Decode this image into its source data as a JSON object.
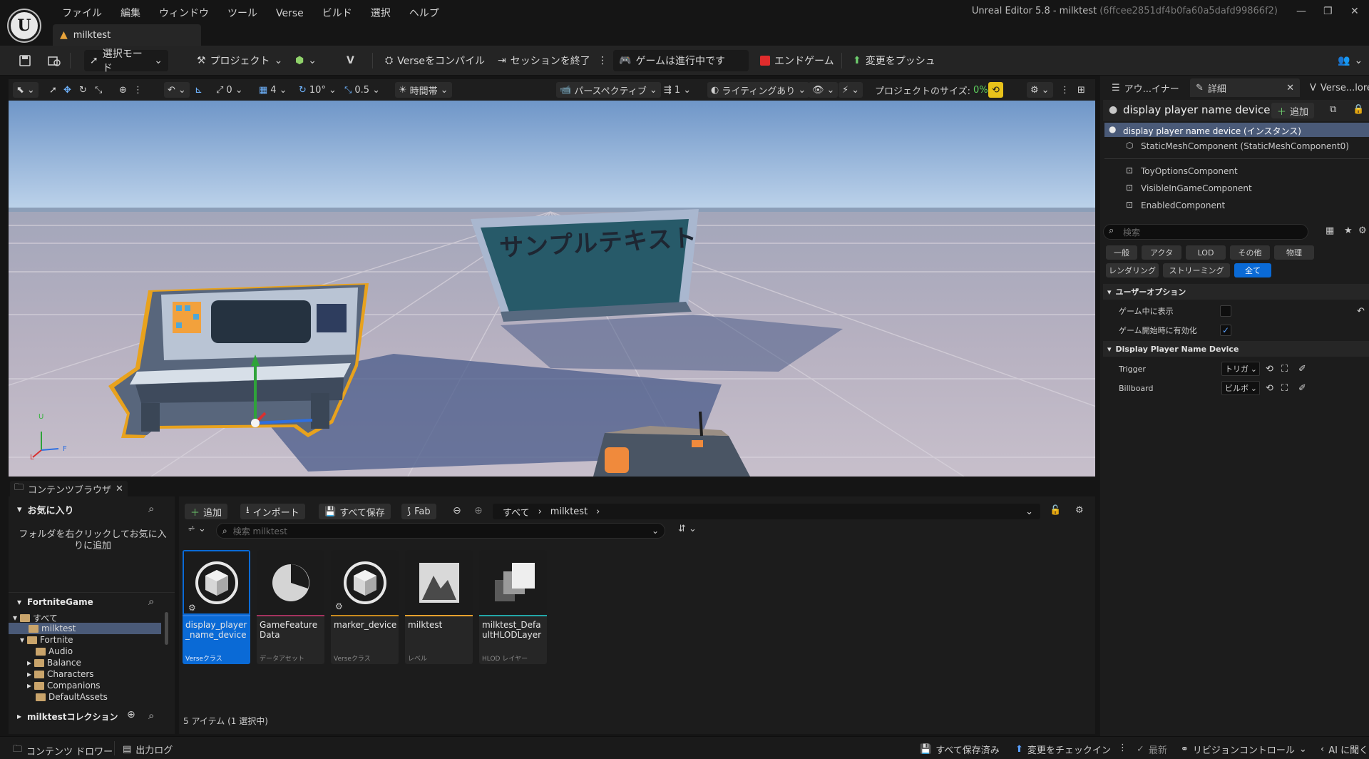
{
  "menubar": {
    "logo": "U",
    "items": [
      "ファイル",
      "編集",
      "ウィンドウ",
      "ツール",
      "Verse",
      "ビルド",
      "選択",
      "ヘルプ"
    ],
    "window_title": "Unreal Editor 5.8 - milktest",
    "window_hash": "(6ffcee2851df4b0fa60a5dafd99866f2)",
    "level_tab": "milktest"
  },
  "toolbar": {
    "select_mode": "選択モード",
    "project": "プロジェクト",
    "compile_verse": "Verseをコンパイル",
    "end_session": "セッションを終了",
    "game_status": "ゲームは進行中です",
    "end_game": "エンドゲーム",
    "push_changes": "変更をプッシュ"
  },
  "viewport_toolbar": {
    "rot_snap": "0",
    "grid_snap": "4",
    "angle_snap": "10°",
    "scale_snap": "0.5",
    "time_of_day": "時間帯",
    "perspective": "パースペクティブ",
    "camera_speed": "1",
    "lighting": "ライティングあり",
    "project_size_label": "プロジェクトのサイズ:",
    "project_size_value": "0%"
  },
  "viewport": {
    "billboard_text": "サンプルテキスト",
    "axis_z": "U",
    "axis_x": "F",
    "axis_y": "L"
  },
  "right_panel": {
    "tabs": [
      "アウ...イナー",
      "詳細",
      "Verse...lorer"
    ],
    "actor_name": "display player name device",
    "add_button": "追加",
    "instance_label": "display player name device (インスタンス)",
    "components": [
      "StaticMeshComponent (StaticMeshComponent0)",
      "ToyOptionsComponent",
      "VisibleInGameComponent",
      "EnabledComponent"
    ],
    "search_placeholder": "検索",
    "filter_row1": [
      "一般",
      "アクタ",
      "LOD",
      "その他",
      "物理"
    ],
    "filter_row2": [
      "レンダリング",
      "ストリーミング",
      "全て"
    ],
    "section_user_options": "ユーザーオプション",
    "opt_visible_in_game": "ゲーム中に表示",
    "opt_enabled_at_start": "ゲーム開始時に有効化",
    "opt_enabled_checkmark": "✓",
    "section_device": "Display Player Name Device",
    "prop_trigger": "Trigger",
    "prop_trigger_value": "トリガ",
    "prop_billboard": "Billboard",
    "prop_billboard_value": "ビルボ"
  },
  "content_browser": {
    "tab_label": "コンテンツブラウザ",
    "favorites_title": "お気に入り",
    "favorites_hint": "フォルダを右クリックしてお気に入りに追加",
    "fortnite_title": "FortniteGame",
    "tree": {
      "all": "すべて",
      "milktest": "milktest",
      "fortnite": "Fortnite",
      "audio": "Audio",
      "balance": "Balance",
      "characters": "Characters",
      "companions": "Companions",
      "default_assets": "DefaultAssets"
    },
    "collections_title": "milktestコレクション",
    "add": "追加",
    "import": "インポート",
    "save_all": "すべて保存",
    "fab": "Fab",
    "path_root": "すべて",
    "path_folder": "milktest",
    "search_placeholder": "検索 milktest",
    "assets": [
      {
        "name": "display_player_name_device",
        "type": "Verseクラス",
        "color": "#2c7ce0"
      },
      {
        "name": "GameFeatureData",
        "type": "データアセット",
        "color": "#a4335f"
      },
      {
        "name": "marker_device",
        "type": "Verseクラス",
        "color": "#c98a1e"
      },
      {
        "name": "milktest",
        "type": "レベル",
        "color": "#e7a12e"
      },
      {
        "name": "milktest_DefaultHLODLayer",
        "type": "HLOD レイヤー",
        "color": "#23a7a9"
      }
    ],
    "item_count": "5 アイテム (1 選択中)"
  },
  "statusbar": {
    "content_drawer": "コンテンツ ドロワー",
    "output_log": "出力ログ",
    "all_saved": "すべて保存済み",
    "check_in": "変更をチェックイン",
    "latest": "最新",
    "revision_control": "リビジョンコントロール",
    "ai_ask": "AI に聞く"
  }
}
